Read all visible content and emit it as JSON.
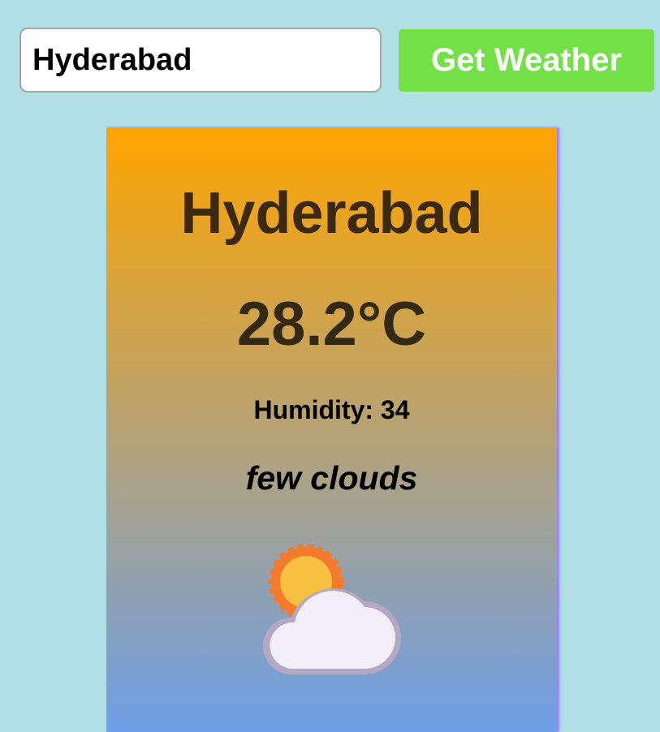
{
  "search": {
    "value": "Hyderabad"
  },
  "button": {
    "label": "Get Weather"
  },
  "weather": {
    "city": "Hyderabad",
    "temperature": "28.2°C",
    "humidity": "Humidity: 34",
    "description": "few clouds",
    "icon": "partly-cloudy-icon"
  },
  "colors": {
    "page_background": "#b0dfe5",
    "button_background": "#73e047",
    "card_gradient_top": "#ffa500",
    "card_gradient_bottom": "#6e9fe8"
  }
}
